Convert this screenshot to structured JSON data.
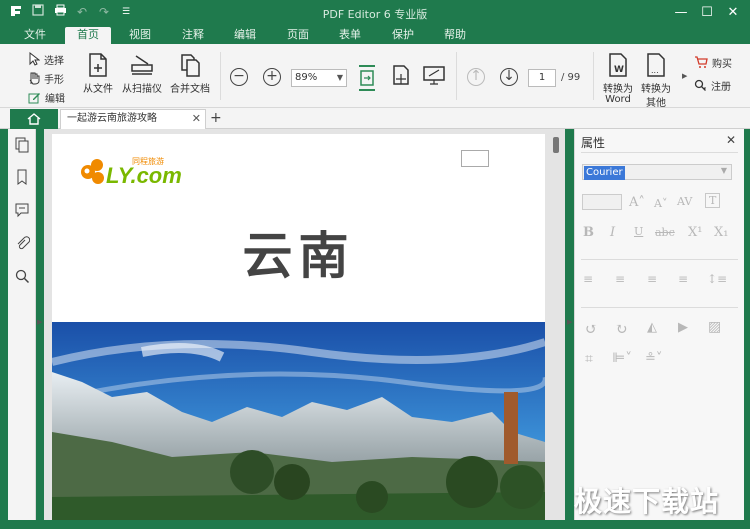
{
  "app": {
    "title": "PDF Editor 6 专业版"
  },
  "titlebar_icons": [
    "app-logo-icon",
    "save-icon",
    "print-icon",
    "undo-icon",
    "redo-icon",
    "customize-icon"
  ],
  "menu": {
    "items": [
      "文件",
      "首页",
      "视图",
      "注释",
      "编辑",
      "页面",
      "表单",
      "保护",
      "帮助"
    ],
    "active": "首页"
  },
  "ribbon": {
    "select": "选择",
    "hand": "手形",
    "edit": "编辑",
    "from_file": "从文件",
    "from_scanner": "从扫描仪",
    "merge": "合并文档",
    "zoom": "89%",
    "page_current": "1",
    "page_total": "/ 99",
    "to_word_line1": "转换为",
    "to_word_line2": "Word",
    "to_other_line1": "转换为",
    "to_other_line2": "其他",
    "buy": "购买",
    "register": "注册"
  },
  "tabs": {
    "document": "一起游云南旅游攻略",
    "home_icon": "home-icon"
  },
  "document": {
    "logo_text": "LY.com",
    "logo_sub": "同程旅游",
    "heading": "云南"
  },
  "properties": {
    "title": "属性",
    "font": "Courier"
  },
  "watermark": "极速下载站",
  "colors": {
    "brand": "#1f7a4d",
    "ribbon_bg": "#f4f4f4",
    "selection": "#3b78d8"
  }
}
